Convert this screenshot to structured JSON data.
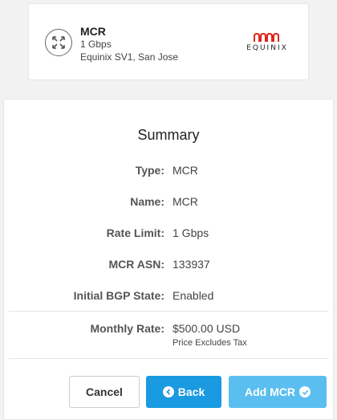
{
  "product": {
    "name": "MCR",
    "speed": "1 Gbps",
    "location": "Equinix SV1, San Jose",
    "provider_logo_text": "EQUINIX",
    "icon": "expand-arrows-icon"
  },
  "summary": {
    "title": "Summary",
    "rows": [
      {
        "label": "Type:",
        "value": "MCR"
      },
      {
        "label": "Name:",
        "value": "MCR"
      },
      {
        "label": "Rate Limit:",
        "value": "1 Gbps"
      },
      {
        "label": "MCR ASN:",
        "value": "133937"
      },
      {
        "label": "Initial BGP State:",
        "value": "Enabled"
      }
    ],
    "monthly_rate_label": "Monthly Rate:",
    "monthly_rate_value": "$500.00 USD",
    "monthly_rate_note": "Price Excludes Tax"
  },
  "buttons": {
    "cancel": "Cancel",
    "back": "Back",
    "add": "Add MCR"
  },
  "colors": {
    "primary": "#1a9ae0",
    "primary_light": "#5bbef0",
    "equinix_red": "#e1251b"
  }
}
